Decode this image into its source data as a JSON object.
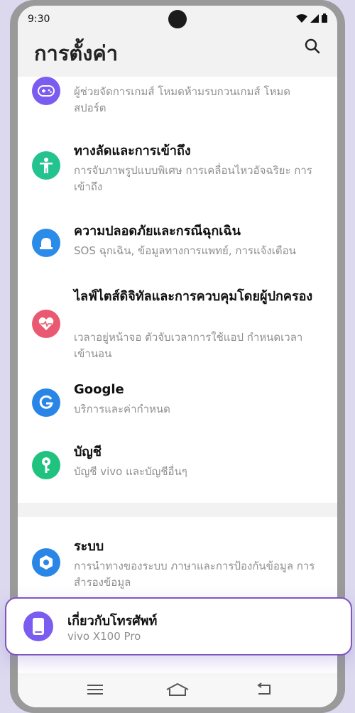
{
  "status_bar": {
    "time": "9:30"
  },
  "header": {
    "title": "การตั้งค่า"
  },
  "items": [
    {
      "id": "game",
      "title": "",
      "subtitle": "ผู้ช่วยจัดการเกมส์ โหมดห้ามรบกวนเกมส์ โหมดสปอร์ต",
      "color": "#7b5cf0",
      "icon": "gamepad-icon"
    },
    {
      "id": "accessibility",
      "title": "ทางลัดและการเข้าถึง",
      "subtitle": "การจับภาพรูปแบบพิเศษ การเคลื่อนไหวอัจฉริยะ การเข้าถึง",
      "color": "#23c28e",
      "icon": "accessibility-icon"
    },
    {
      "id": "safety",
      "title": "ความปลอดภัยและกรณีฉุกเฉิน",
      "subtitle": "SOS ฉุกเฉิน, ข้อมูลทางการแพทย์, การแจ้งเตือน",
      "color": "#2a8ce8",
      "icon": "siren-icon"
    },
    {
      "id": "wellbeing",
      "title": "ไลฟ์ไตส์ดิจิทัลและการควบคุมโดยผู้ปกครอง",
      "subtitle": "เวลาอยู่หน้าจอ ตัวจับเวลาการใช้แอป กำหนดเวลาเข้านอน",
      "color": "#e95a72",
      "icon": "heart-icon"
    },
    {
      "id": "google",
      "title": "Google",
      "subtitle": "บริการและค่ากำหนด",
      "color": "#2a86e6",
      "icon": "google-icon"
    },
    {
      "id": "accounts",
      "title": "บัญชี",
      "subtitle": "บัญชี vivo และบัญชีอื่นๆ",
      "color": "#1fc27f",
      "icon": "key-icon"
    },
    {
      "id": "system",
      "title": "ระบบ",
      "subtitle": "การนำทางของระบบ ภาษาและการป้องกันข้อมูล การสำรองข้อมูล",
      "color": "#2a86e6",
      "icon": "hexagon-gear-icon"
    }
  ],
  "highlight": {
    "title": "เกี่ยวกับโทรศัพท์",
    "subtitle": "vivo X100 Pro",
    "color": "#7a5cf0",
    "icon": "phone-icon"
  },
  "nav": {
    "menu_icon": "menu-icon",
    "home_icon": "home-icon",
    "back_icon": "back-icon"
  }
}
